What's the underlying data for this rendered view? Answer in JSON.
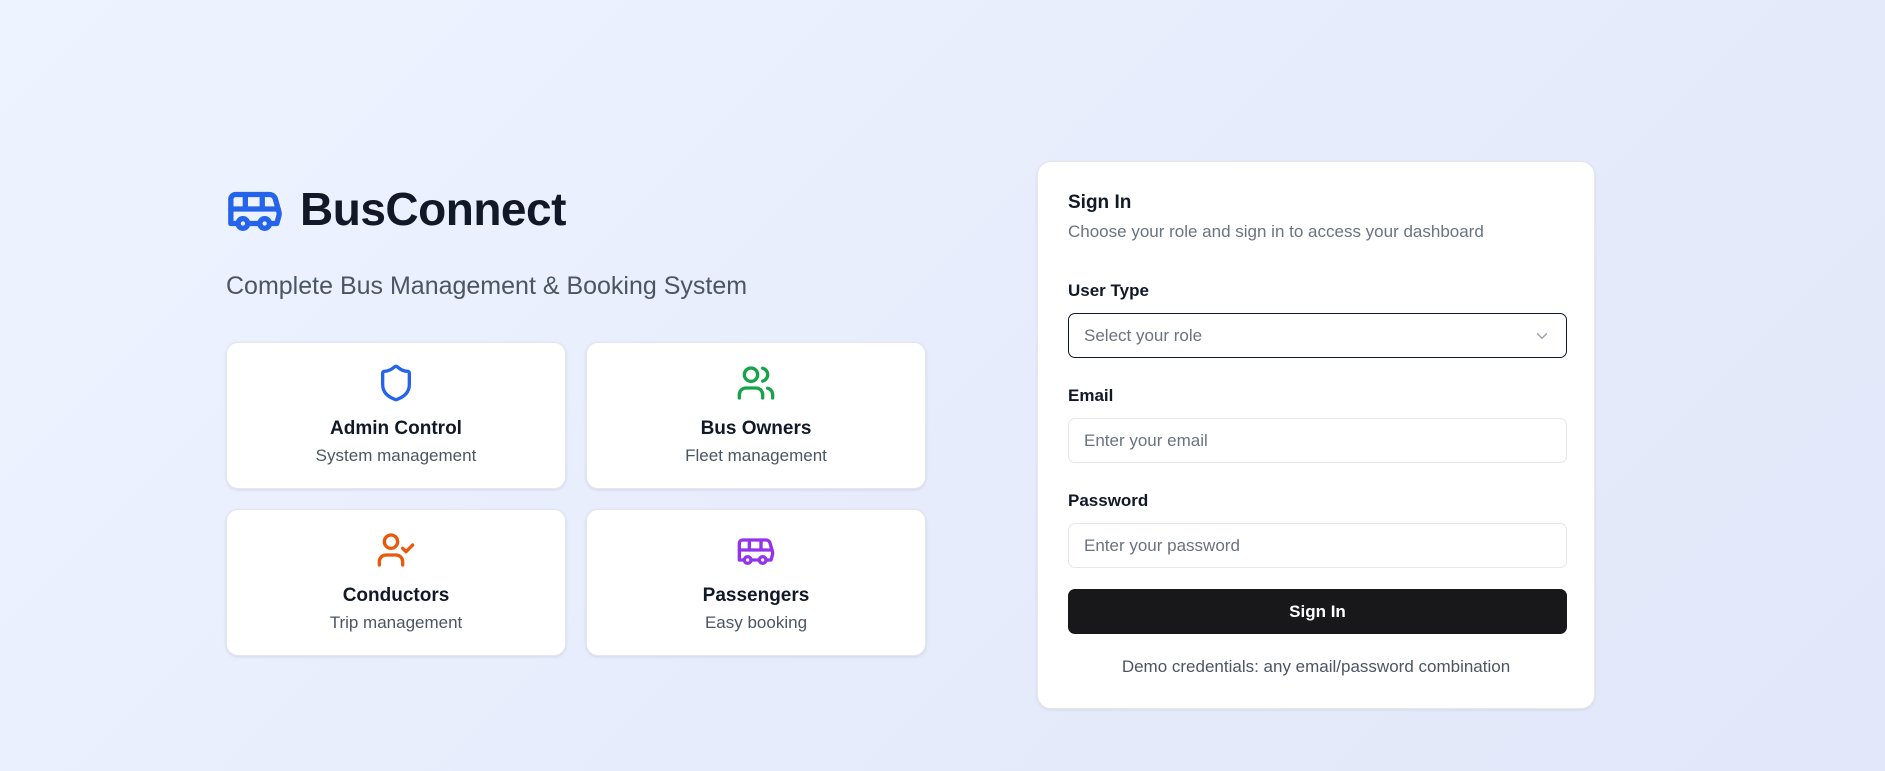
{
  "brand": {
    "title": "BusConnect",
    "tagline": "Complete Bus Management & Booking System",
    "icon": "bus-icon",
    "color": "#2563eb"
  },
  "features": [
    {
      "title": "Admin Control",
      "subtitle": "System management",
      "icon": "shield-icon",
      "color": "#2563eb"
    },
    {
      "title": "Bus Owners",
      "subtitle": "Fleet management",
      "icon": "users-icon",
      "color": "#16a34a"
    },
    {
      "title": "Conductors",
      "subtitle": "Trip management",
      "icon": "user-check-icon",
      "color": "#ea580c"
    },
    {
      "title": "Passengers",
      "subtitle": "Easy booking",
      "icon": "bus-icon",
      "color": "#9333ea"
    }
  ],
  "signin": {
    "title": "Sign In",
    "description": "Choose your role and sign in to access your dashboard",
    "user_type_label": "User Type",
    "user_type_placeholder": "Select your role",
    "email_label": "Email",
    "email_placeholder": "Enter your email",
    "password_label": "Password",
    "password_placeholder": "Enter your password",
    "button_label": "Sign In",
    "demo_text": "Demo credentials: any email/password combination"
  }
}
